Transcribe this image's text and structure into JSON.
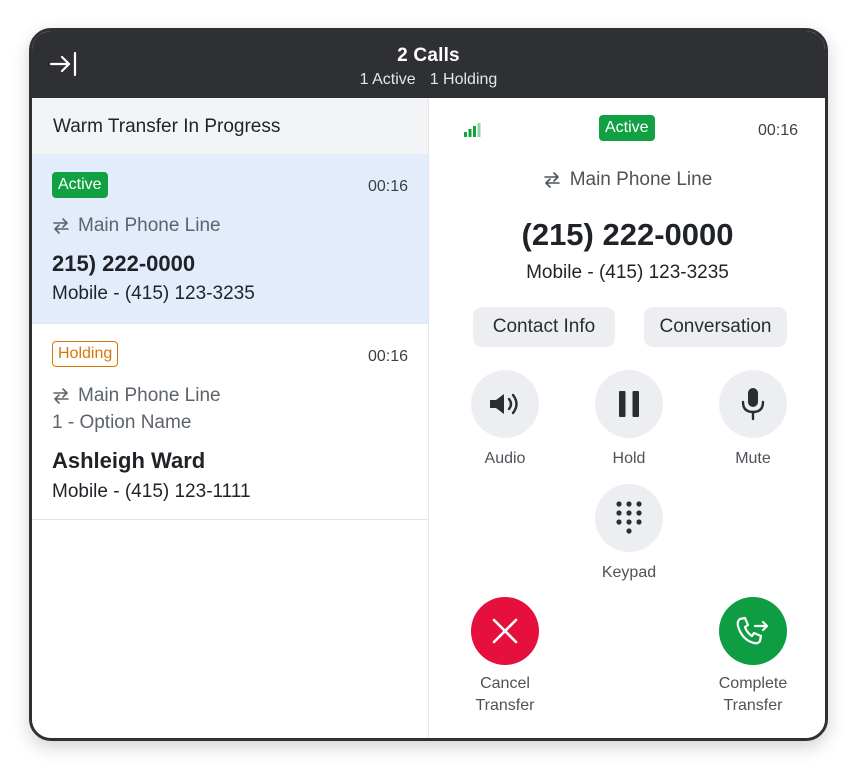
{
  "titlebar": {
    "title": "2 Calls",
    "active_count": "1 Active",
    "holding_count": "1 Holding"
  },
  "left_panel": {
    "header": "Warm Transfer In Progress",
    "calls": [
      {
        "status": "Active",
        "timer": "00:16",
        "line": "Main Phone Line",
        "number": "215) 222-0000",
        "sub": "Mobile - (415) 123-3235"
      },
      {
        "status": "Holding",
        "timer": "00:16",
        "line": "Main Phone Line",
        "option": "1 - Option Name",
        "name": "Ashleigh Ward",
        "sub": "Mobile - (415) 123-1111"
      }
    ]
  },
  "right_panel": {
    "status": "Active",
    "timer": "00:16",
    "line": "Main Phone Line",
    "number": "(215) 222-0000",
    "sub": "Mobile - (415) 123-3235",
    "contact_info_label": "Contact Info",
    "conversation_label": "Conversation",
    "controls": {
      "audio": "Audio",
      "hold": "Hold",
      "mute": "Mute",
      "keypad": "Keypad",
      "cancel_line1": "Cancel",
      "cancel_line2": "Transfer",
      "complete_line1": "Complete",
      "complete_line2": "Transfer"
    }
  },
  "icons": {
    "collapse": "collapse-right-icon",
    "transfer": "transfer-arrows-icon",
    "signal": "signal-strength-icon",
    "audio": "speaker-icon",
    "hold": "pause-icon",
    "mute": "microphone-icon",
    "keypad": "dialpad-icon",
    "cancel": "close-icon",
    "complete": "phone-transfer-icon"
  },
  "colors": {
    "active_green": "#12a142",
    "holding_orange": "#d97706",
    "cancel_red": "#e5103d",
    "complete_green": "#0f9d43",
    "titlebar": "#2f3033",
    "selected_bg": "#e2ecfb"
  }
}
